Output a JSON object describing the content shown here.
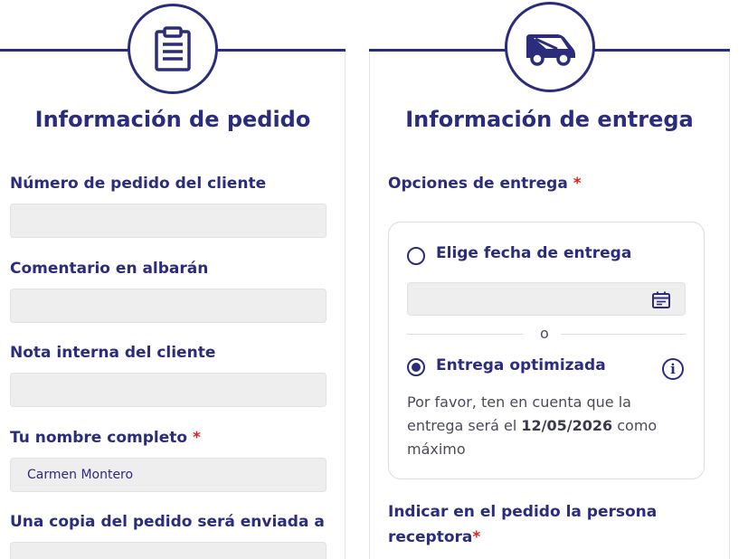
{
  "order_section": {
    "title": "Información de pedido",
    "icon": "clipboard-icon",
    "fields": [
      {
        "label": "Número de pedido del cliente",
        "value": "",
        "required": false
      },
      {
        "label": "Comentario en albarán",
        "value": "",
        "required": false
      },
      {
        "label": "Nota interna del cliente",
        "value": "",
        "required": false
      },
      {
        "label": "Tu nombre completo",
        "value": "Carmen Montero",
        "required": true
      },
      {
        "label": "Una copia del pedido será enviada a",
        "value": "",
        "required": false
      }
    ],
    "required_mark": "*"
  },
  "delivery_section": {
    "title": "Información de entrega",
    "icon": "delivery-van-icon",
    "options_label": "Opciones de entrega",
    "required_mark": "*",
    "option_choose_date": {
      "label": "Elige fecha de entrega",
      "selected": false,
      "date_value": ""
    },
    "divider_text": "o",
    "option_optimized": {
      "label": "Entrega optimizada",
      "selected": true
    },
    "note_prefix": "Por favor, ten en cuenta que la entrega será el",
    "note_date": "12/05/2026",
    "note_suffix": "como máximo",
    "receiver_label": "Indicar en el pedido la persona receptora"
  },
  "colors": {
    "primary": "#2b2c7c",
    "required": "#e02020",
    "input_bg": "#eeeeee"
  }
}
